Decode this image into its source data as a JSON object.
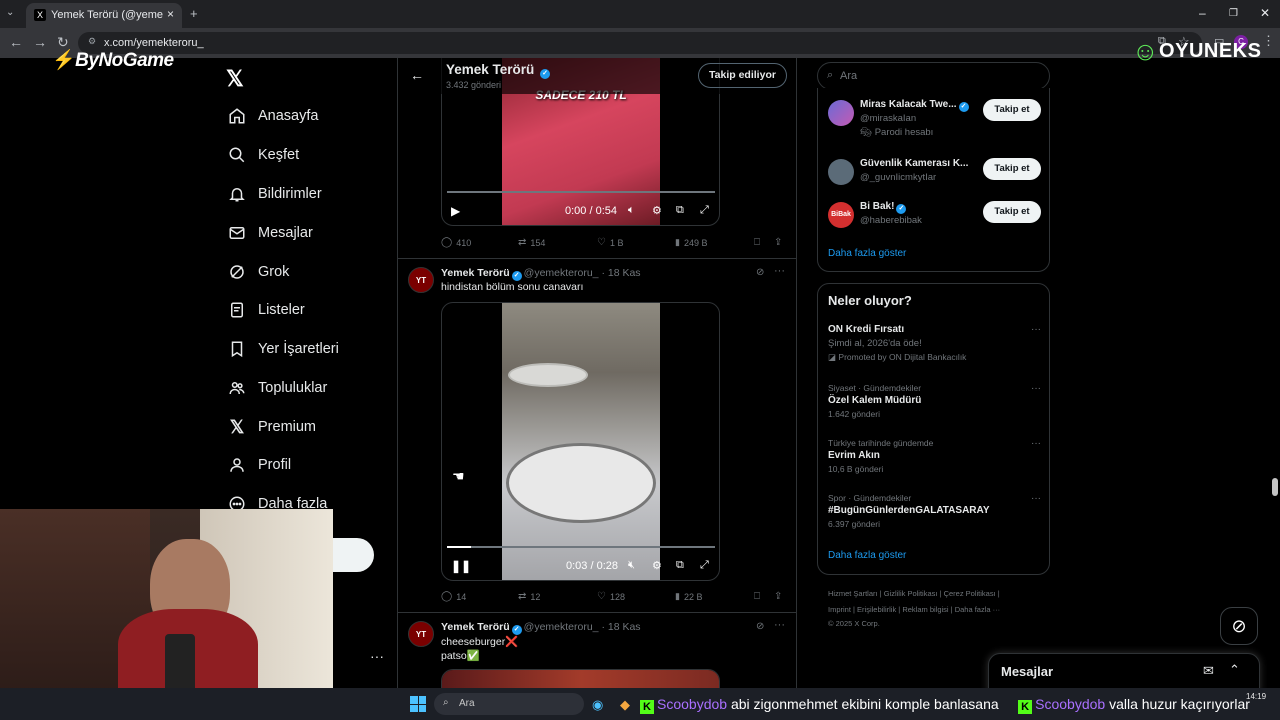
{
  "browser": {
    "tab_title": "Yemek Terörü (@yemekteroru_)",
    "url": "x.com/yemekteroru_"
  },
  "overlays": {
    "left_logo": "ByNoGame",
    "right_logo": "OYUNEKS"
  },
  "sidebar": {
    "items": [
      {
        "label": "Anasayfa",
        "icon": "home-icon"
      },
      {
        "label": "Keşfet",
        "icon": "search-icon"
      },
      {
        "label": "Bildirimler",
        "icon": "bell-icon"
      },
      {
        "label": "Mesajlar",
        "icon": "mail-icon"
      },
      {
        "label": "Grok",
        "icon": "grok-icon"
      },
      {
        "label": "Listeler",
        "icon": "list-icon"
      },
      {
        "label": "Yer İşaretleri",
        "icon": "bookmark-icon"
      },
      {
        "label": "Topluluklar",
        "icon": "people-icon"
      },
      {
        "label": "Premium",
        "icon": "x-icon"
      },
      {
        "label": "Profil",
        "icon": "profile-icon"
      },
      {
        "label": "Daha fazla",
        "icon": "more-circle-icon"
      }
    ],
    "post_button_partial": "a"
  },
  "profile_header": {
    "name": "Yemek Terörü",
    "posts_count": "3.432 gönderi",
    "follow_state": "Takip ediliyor"
  },
  "tweets": [
    {
      "video_caption": "SADECE 210 TL",
      "time": "0:00 / 0:54",
      "progress": 0,
      "replies": "410",
      "reposts": "154",
      "likes": "1 B",
      "views": "249 B"
    },
    {
      "name": "Yemek Terörü",
      "handle": "@yemekteroru_",
      "date": "· 18 Kas",
      "text": "hindistan bölüm sonu canavarı",
      "time": "0:03 / 0:28",
      "progress": 0.09,
      "replies": "14",
      "reposts": "12",
      "likes": "128",
      "views": "22 B"
    },
    {
      "name": "Yemek Terörü",
      "handle": "@yemekteroru_",
      "date": "· 18 Kas",
      "text_line1": "cheeseburger❌",
      "text_line2": "patso✅"
    }
  ],
  "search": {
    "placeholder": "Ara"
  },
  "who_to_follow": {
    "accounts": [
      {
        "name": "Miras Kalacak Twe...",
        "handle": "@miraskaIan",
        "sub": "Parodi hesabı",
        "button": "Takip et"
      },
      {
        "name": "Güvenlik Kamerası K...",
        "handle": "@_guvnIicmkytIar",
        "button": "Takip et"
      },
      {
        "name": "Bi Bak!",
        "handle": "@haberebibak",
        "button": "Takip et"
      }
    ],
    "show_more": "Daha fazla göster"
  },
  "trends": {
    "title": "Neler oluyor?",
    "items": [
      {
        "category": "",
        "title": "ON Kredi Fırsatı",
        "subtitle": "Şimdi al, 2026'da öde!",
        "count": "Promoted by ON Dijital Bankacılık"
      },
      {
        "category": "Siyaset · Gündemdekiler",
        "title": "Özel Kalem Müdürü",
        "count": "1.642 gönderi"
      },
      {
        "category": "Türkiye tarihinde gündemde",
        "title": "Evrim Akın",
        "count": "10,6 B gönderi"
      },
      {
        "category": "Spor · Gündemdekiler",
        "title": "#BugünGünlerdenGALATASARAY",
        "count": "6.397 gönderi"
      }
    ],
    "show_more": "Daha fazla göster"
  },
  "footer": {
    "line1": "Hizmet Şartları  |  Gizlilik Politikası  |  Çerez Politikası  |",
    "line2": "Imprint  |  Erişilebilirlik  |  Reklam bilgisi  |  Daha fazla ···",
    "line3": "© 2025 X Corp."
  },
  "messages_drawer": {
    "label": "Mesajlar"
  },
  "taskbar": {
    "search_placeholder": "Ara",
    "clock": "14:19"
  },
  "chat_ticker": {
    "msg1_user": "Scoobydob",
    "msg1_text": " abi zigonmehmet ekibini komple banlasana",
    "msg2_user": "Scoobydob",
    "msg2_text": " valla huzur kaçırıyorlar"
  },
  "colors": {
    "accent": "#1d9bf0",
    "background": "#000000",
    "border": "#2f3336",
    "kick_green": "#53fc18"
  }
}
